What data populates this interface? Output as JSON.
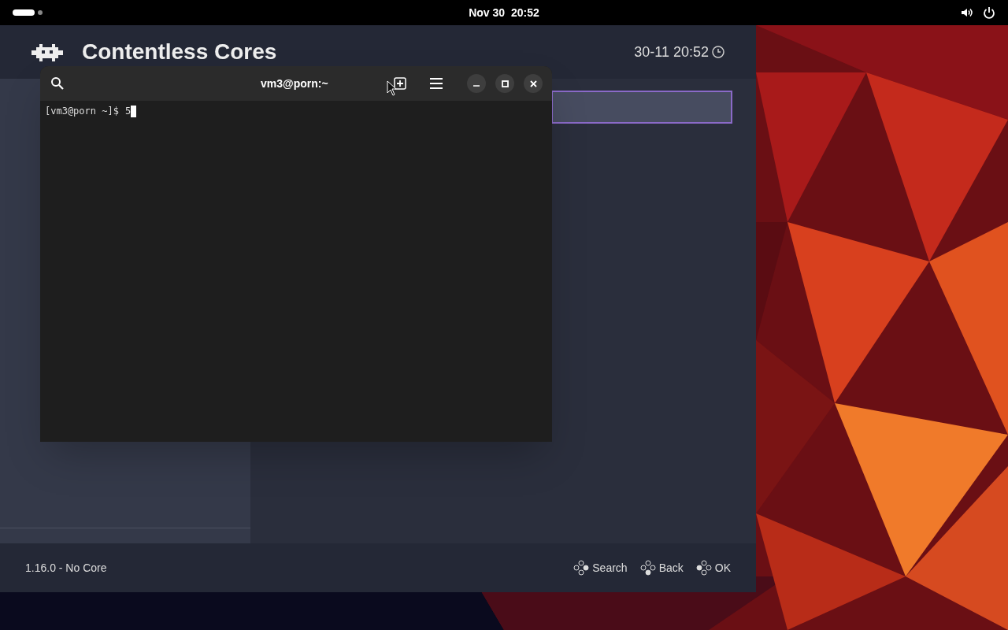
{
  "top_bar": {
    "date": "Nov 30",
    "time": "20:52"
  },
  "retroarch": {
    "title": "Contentless Cores",
    "clock": "30-11 20:52",
    "version": "1.16.0 - No Core",
    "footer_buttons": [
      {
        "label": "Search"
      },
      {
        "label": "Back"
      },
      {
        "label": "OK"
      }
    ]
  },
  "terminal": {
    "title": "vm3@porn:~",
    "prompt": "[vm3@porn ~]$",
    "input": "5"
  }
}
